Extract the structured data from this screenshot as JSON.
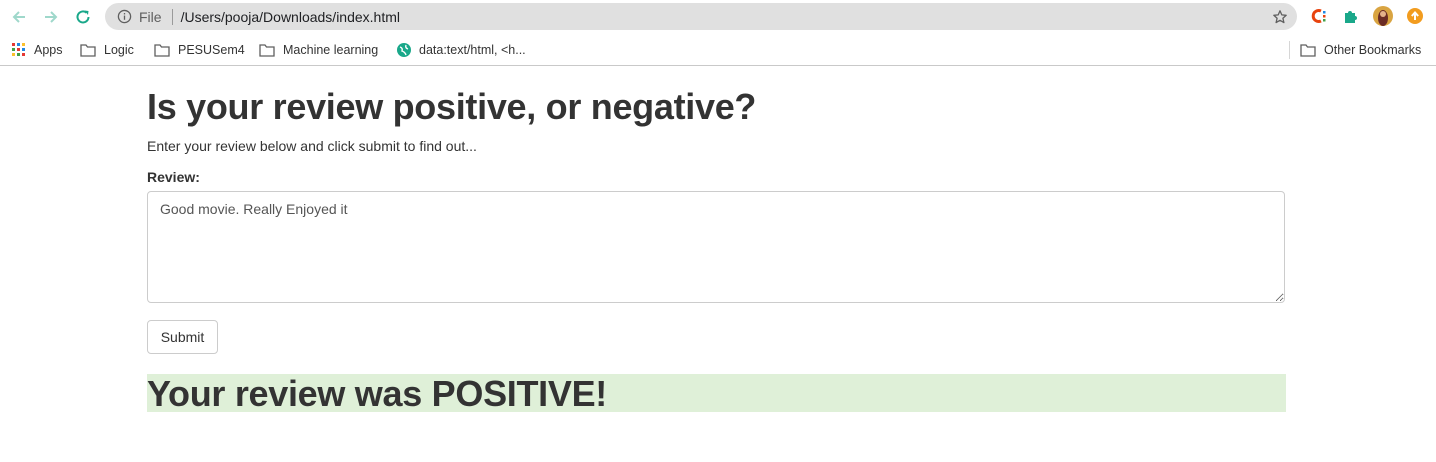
{
  "browser": {
    "address_bar": {
      "scheme_label": "File",
      "url": "/Users/pooja/Downloads/index.html"
    },
    "bookmarks": [
      {
        "label": "Apps",
        "icon": "apps-grid-icon"
      },
      {
        "label": "Logic",
        "icon": "folder-icon"
      },
      {
        "label": "PESUSem4",
        "icon": "folder-icon"
      },
      {
        "label": "Machine learning",
        "icon": "folder-icon"
      },
      {
        "label": "data:text/html, <h...",
        "icon": "globe-icon"
      }
    ],
    "other_bookmarks": "Other Bookmarks"
  },
  "page": {
    "title": "Is your review positive, or negative?",
    "intro": "Enter your review below and click submit to find out...",
    "review_label": "Review:",
    "review_text": "Good movie. Really Enjoyed it",
    "submit_label": "Submit",
    "result": "Your review was POSITIVE!"
  },
  "colors": {
    "result_background": "#dff0d8",
    "nav_accent": "#3cba9f"
  }
}
